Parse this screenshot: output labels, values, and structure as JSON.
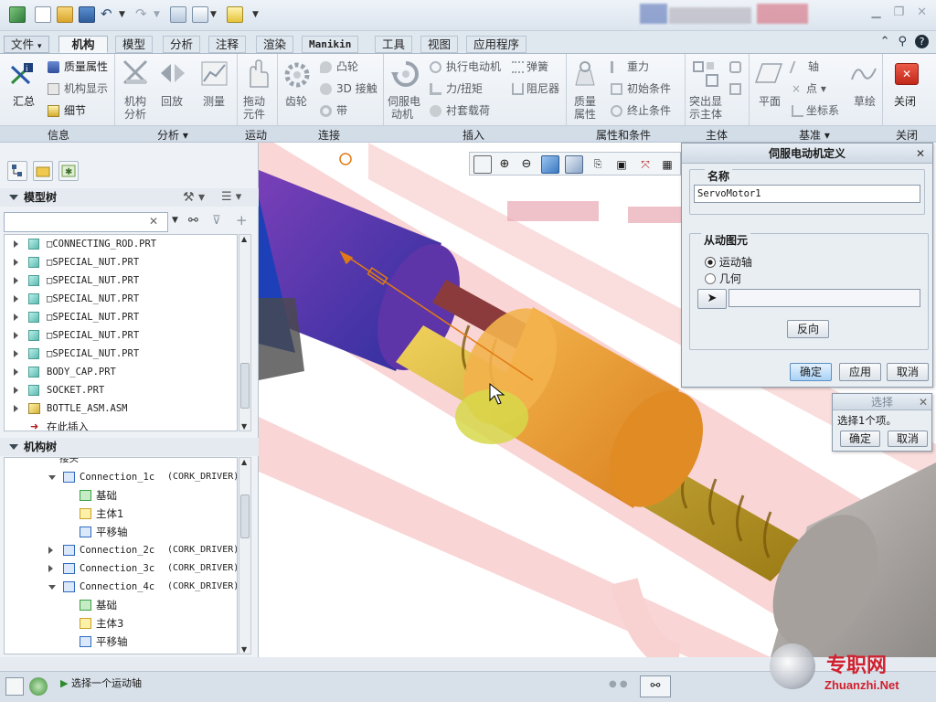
{
  "ribbon_tabs": [
    {
      "label": "文件",
      "caret": "▾"
    },
    {
      "label": "机构"
    },
    {
      "label": "模型"
    },
    {
      "label": "分析"
    },
    {
      "label": "注释"
    },
    {
      "label": "渲染"
    },
    {
      "label": "Manikin"
    },
    {
      "label": "工具"
    },
    {
      "label": "视图"
    },
    {
      "label": "应用程序"
    }
  ],
  "ribbon": {
    "info": {
      "summary": "汇总",
      "mass_props": "质量属性",
      "mech_display": "机构显示",
      "detail": "细节",
      "group": "信息"
    },
    "analysis": {
      "mech_analysis": [
        "机构",
        "分析"
      ],
      "playback": "回放",
      "measure": "测量",
      "group": "分析 ▾"
    },
    "motion": {
      "drag": [
        "拖动",
        "元件"
      ],
      "group": "运动"
    },
    "connections": {
      "gear": "齿轮",
      "cam": "凸轮",
      "contact_3d": "3D 接触",
      "belt": "带",
      "group": "连接"
    },
    "insert": {
      "servo": [
        "伺服电",
        "动机"
      ],
      "actuator_motor": "执行电动机",
      "force_torque": "力/扭矩",
      "bushing_load": "衬套载荷",
      "spring": "弹簧",
      "damper": "阻尼器",
      "group": "插入"
    },
    "properties": {
      "mass_props": [
        "质量",
        "属性"
      ],
      "gravity": "重力",
      "init_conditions": "初始条件",
      "term_conditions": "终止条件",
      "group": "属性和条件"
    },
    "body": {
      "highlight": [
        "突出显",
        "示主体"
      ],
      "group": "主体"
    },
    "datum": {
      "plane": "平面",
      "axis": "轴",
      "point": "点 ▾",
      "csys": "坐标系",
      "sketch": "草绘",
      "group": "基准 ▾"
    },
    "close": {
      "label": "关闭",
      "group": "关闭"
    }
  },
  "model_tree": {
    "title": "模型树",
    "items": [
      {
        "type": "prt",
        "label": "□CONNECTING_ROD.PRT"
      },
      {
        "type": "prt",
        "label": "□SPECIAL_NUT.PRT"
      },
      {
        "type": "prt",
        "label": "□SPECIAL_NUT.PRT"
      },
      {
        "type": "prt",
        "label": "□SPECIAL_NUT.PRT"
      },
      {
        "type": "prt",
        "label": "□SPECIAL_NUT.PRT"
      },
      {
        "type": "prt",
        "label": "□SPECIAL_NUT.PRT"
      },
      {
        "type": "prt",
        "label": "□SPECIAL_NUT.PRT"
      },
      {
        "type": "prt",
        "label": "BODY_CAP.PRT"
      },
      {
        "type": "prt",
        "label": "SOCKET.PRT"
      },
      {
        "type": "asm",
        "label": "BOTTLE_ASM.ASM"
      },
      {
        "type": "insert",
        "label": "在此插入"
      }
    ]
  },
  "mech_tree": {
    "title": "机构树",
    "items": [
      {
        "indent": 2,
        "exp": "down",
        "icon": "conn",
        "label": "Connection_1c",
        "ctx": "(CORK_DRIVER)"
      },
      {
        "indent": 3,
        "icon": "base",
        "label": "基础"
      },
      {
        "indent": 3,
        "icon": "body",
        "label": "主体1"
      },
      {
        "indent": 3,
        "icon": "slider",
        "label": "平移轴"
      },
      {
        "indent": 2,
        "exp": "right",
        "icon": "conn2",
        "label": "Connection_2c",
        "ctx": "(CORK_DRIVER)"
      },
      {
        "indent": 2,
        "exp": "right",
        "icon": "conn3",
        "label": "Connection_3c",
        "ctx": "(CORK_DRIVER)"
      },
      {
        "indent": 2,
        "exp": "down",
        "icon": "conn",
        "label": "Connection_4c",
        "ctx": "(CORK_DRIVER)"
      },
      {
        "indent": 3,
        "icon": "base",
        "label": "基础"
      },
      {
        "indent": 3,
        "icon": "body",
        "label": "主体3"
      },
      {
        "indent": 3,
        "icon": "slider",
        "label": "平移轴"
      }
    ],
    "partial_top": "接头"
  },
  "servo_dialog": {
    "title": "伺服电动机定义",
    "name_label": "名称",
    "name_value": "ServoMotor1",
    "driven_label": "从动图元",
    "option_motion_axis": "运动轴",
    "option_geometry": "几何",
    "selected_option": "运动轴",
    "reverse": "反向",
    "ok": "确定",
    "apply": "应用",
    "cancel": "取消"
  },
  "select_dialog": {
    "title": "选择",
    "message": "选择1个项。",
    "ok": "确定",
    "cancel": "取消"
  },
  "status": {
    "message": "选择一个运动轴"
  },
  "watermark": {
    "brand_cn": "专职网",
    "url": "Zhuanzhi.Net"
  },
  "colors": {
    "accent": "#3c79c4",
    "close_red": "#d43a2c",
    "tab_active": "#f4f7fa",
    "servo_orange": "#f2a338"
  }
}
